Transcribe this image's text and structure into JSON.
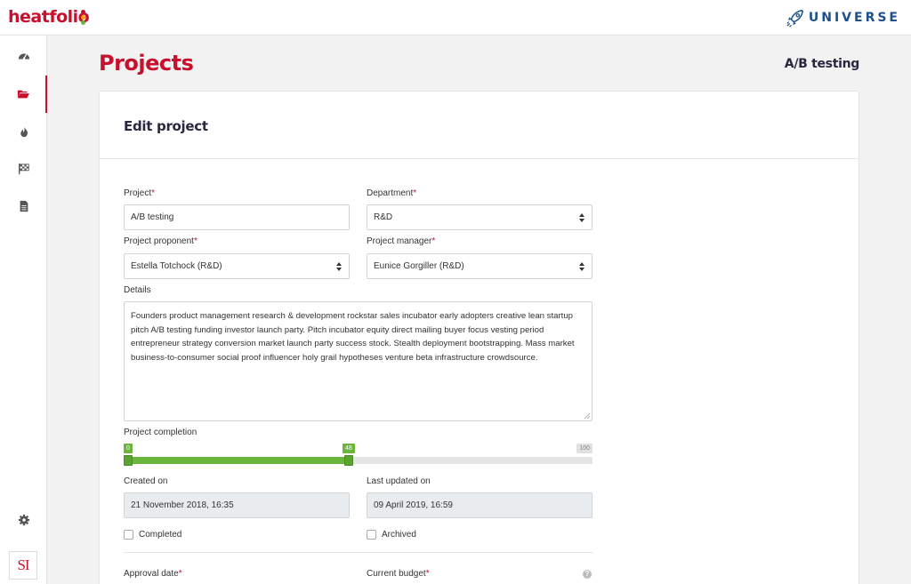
{
  "app": {
    "logo_text": "heatfolio",
    "brand": "UNIVERSE",
    "avatar_initials": "SI"
  },
  "colors": {
    "accent": "#c8102e",
    "progress": "#6ab63c",
    "brand_blue": "#1d4f8c"
  },
  "sidebar": {
    "items": [
      {
        "name": "dashboard",
        "icon": "gauge-icon",
        "active": false
      },
      {
        "name": "projects",
        "icon": "folder-open-icon",
        "active": true
      },
      {
        "name": "heat",
        "icon": "fire-icon",
        "active": false
      },
      {
        "name": "milestones",
        "icon": "checkered-flag-icon",
        "active": false
      },
      {
        "name": "reports",
        "icon": "document-icon",
        "active": false
      }
    ],
    "bottom": [
      {
        "name": "settings",
        "icon": "gear-icon"
      }
    ]
  },
  "header": {
    "title": "Projects",
    "context": "A/B testing"
  },
  "card": {
    "title": "Edit project"
  },
  "form": {
    "project_label": "Project",
    "project_value": "A/B testing",
    "department_label": "Department",
    "department_value": "R&D",
    "proponent_label": "Project proponent",
    "proponent_value": "Estella Totchock (R&D)",
    "manager_label": "Project manager",
    "manager_value": "Eunice Gorgiller (R&D)",
    "details_label": "Details",
    "details_value": "Founders product management research & development rockstar sales incubator early adopters creative lean startup pitch A/B testing funding investor launch party. Pitch incubator equity direct mailing buyer focus vesting period entrepreneur strategy conversion market launch party success stock. Stealth deployment bootstrapping. Mass market business-to-consumer social proof influencer holy grail hypotheses venture beta infrastructure crowdsource.",
    "completion_label": "Project completion",
    "completion": {
      "min": "0",
      "value": "48",
      "max": "100",
      "fraction": 0.48
    },
    "created_label": "Created on",
    "created_value": "21 November 2018, 16:35",
    "updated_label": "Last updated on",
    "updated_value": "09 April 2019, 16:59",
    "completed_label": "Completed",
    "archived_label": "Archived",
    "approval_label": "Approval date",
    "budget_label": "Current budget",
    "required_mark": "*",
    "help_glyph": "?"
  }
}
